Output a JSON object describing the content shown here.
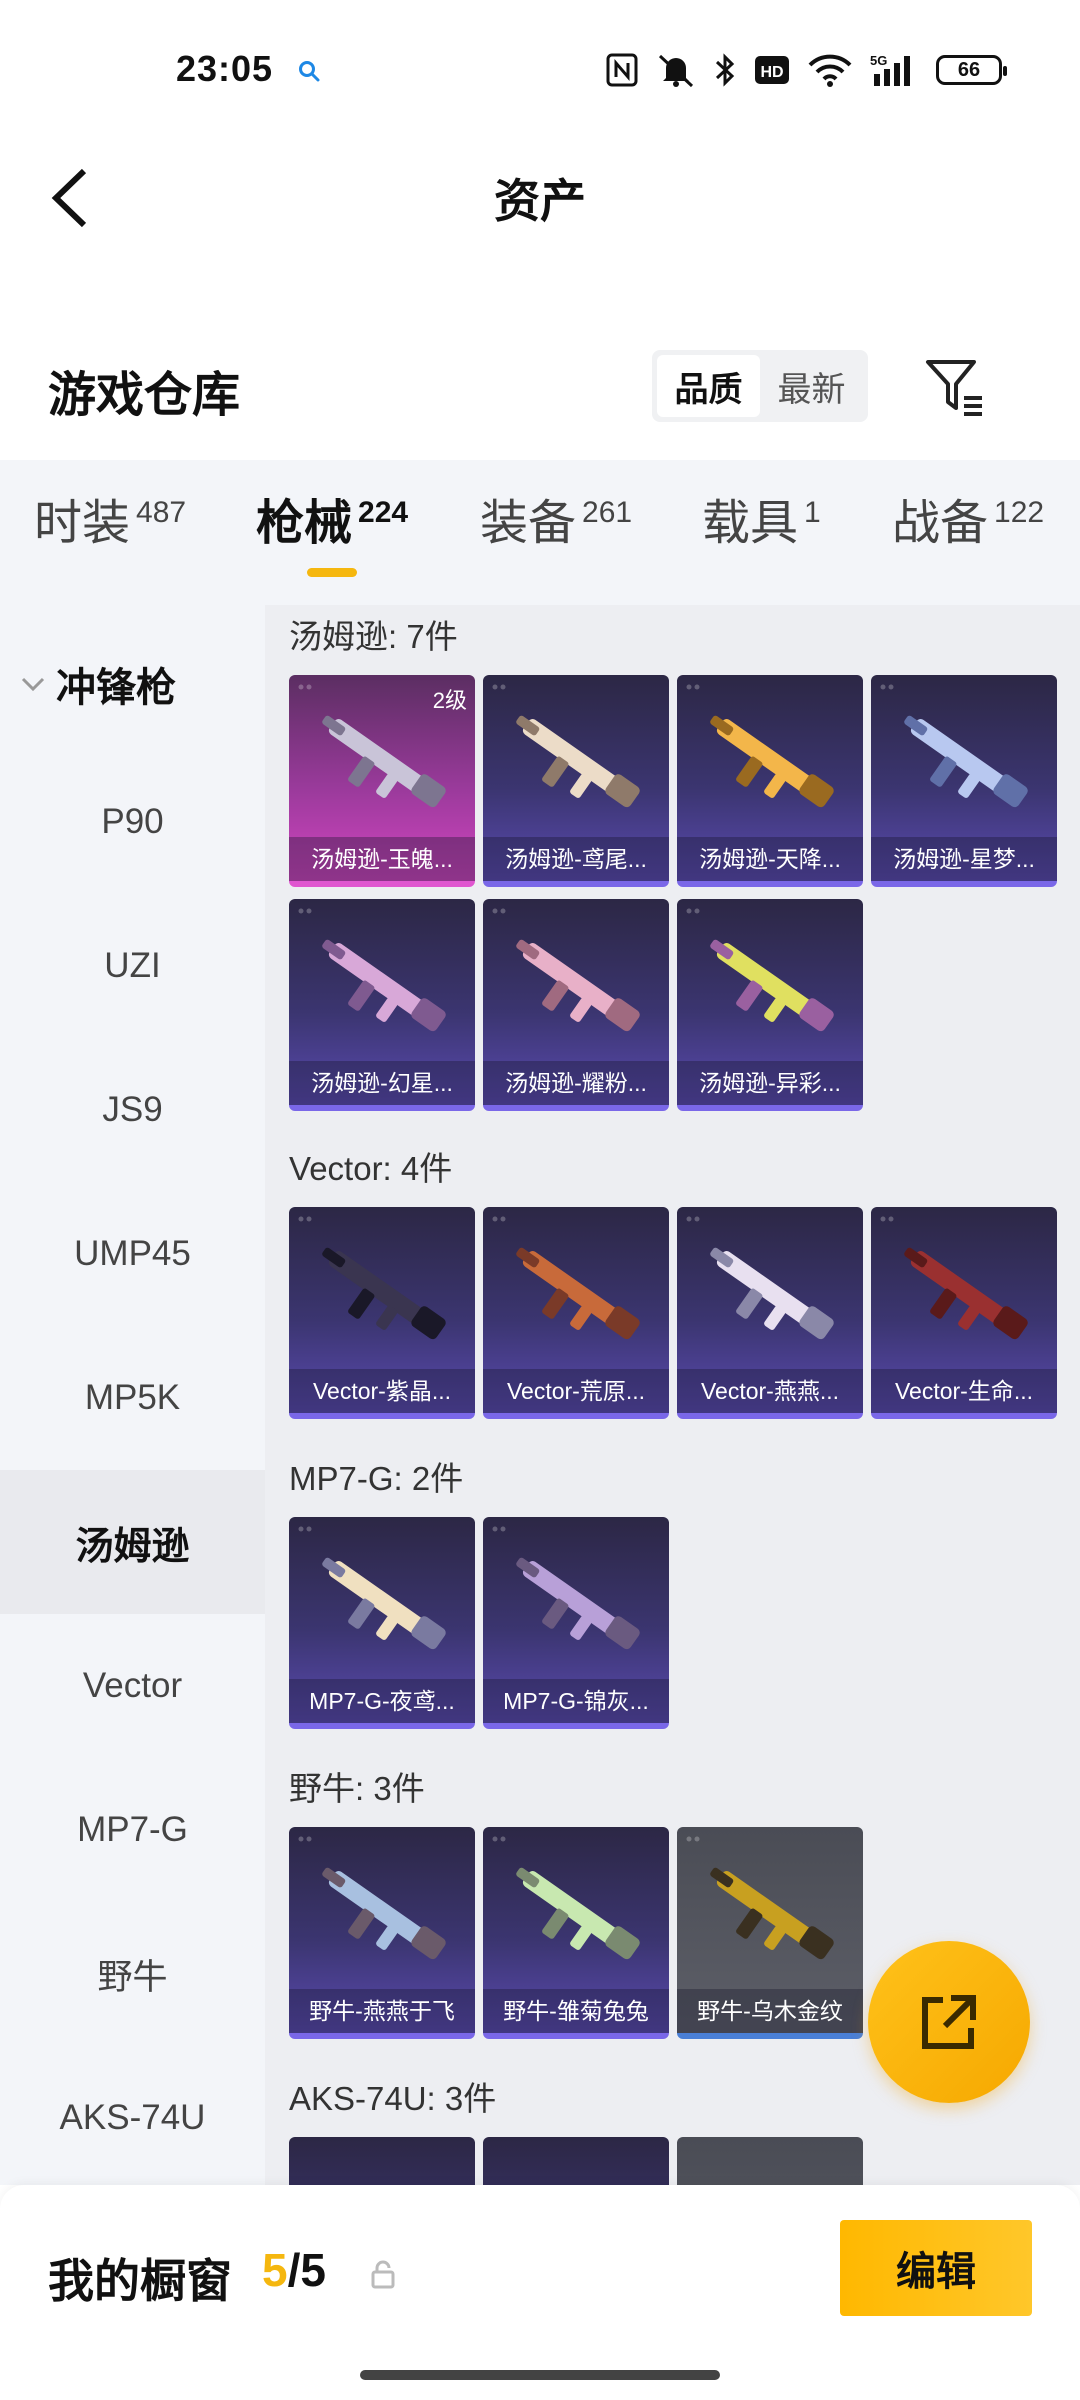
{
  "status_bar": {
    "time": "23:05",
    "battery": "66",
    "icons": [
      "search-icon",
      "nfc-icon",
      "mute-icon",
      "bluetooth-icon",
      "hd-icon",
      "wifi-icon",
      "5g-signal-icon",
      "battery-icon"
    ]
  },
  "header": {
    "title": "资产",
    "back_icon": "chevron-left-icon"
  },
  "section": {
    "title": "游戏仓库",
    "sort_options": [
      "品质",
      "最新"
    ],
    "sort_selected": "品质",
    "filter_icon": "filter-icon"
  },
  "tabs": [
    {
      "label": "时装",
      "count": "487"
    },
    {
      "label": "枪械",
      "count": "224",
      "active": true
    },
    {
      "label": "装备",
      "count": "261"
    },
    {
      "label": "载具",
      "count": "1"
    },
    {
      "label": "战备",
      "count": "122"
    }
  ],
  "sidebar": {
    "category": "冲锋枪",
    "items": [
      "P90",
      "UZI",
      "JS9",
      "UMP45",
      "MP5K",
      "汤姆逊",
      "Vector",
      "MP7-G",
      "野牛",
      "AKS-74U"
    ],
    "active": "汤姆逊"
  },
  "groups": [
    {
      "title": "汤姆逊: 7件",
      "items": [
        {
          "name": "汤姆逊-玉魄...",
          "level": "2级",
          "tier": "pink"
        },
        {
          "name": "汤姆逊-鸢尾...",
          "tier": "purple"
        },
        {
          "name": "汤姆逊-天降...",
          "tier": "purple"
        },
        {
          "name": "汤姆逊-星梦...",
          "tier": "purple"
        },
        {
          "name": "汤姆逊-幻星...",
          "tier": "purple"
        },
        {
          "name": "汤姆逊-耀粉...",
          "tier": "purple"
        },
        {
          "name": "汤姆逊-异彩...",
          "tier": "purple"
        }
      ]
    },
    {
      "title": "Vector: 4件",
      "items": [
        {
          "name": "Vector-紫晶...",
          "tier": "purple"
        },
        {
          "name": "Vector-荒原...",
          "tier": "purple"
        },
        {
          "name": "Vector-燕燕...",
          "tier": "purple"
        },
        {
          "name": "Vector-生命...",
          "tier": "purple"
        }
      ]
    },
    {
      "title": "MP7-G: 2件",
      "items": [
        {
          "name": "MP7-G-夜鸢...",
          "tier": "purple"
        },
        {
          "name": "MP7-G-锦灰...",
          "tier": "purple"
        }
      ]
    },
    {
      "title": "野牛: 3件",
      "items": [
        {
          "name": "野牛-燕燕于飞",
          "tier": "purple"
        },
        {
          "name": "野牛-雏菊兔兔",
          "tier": "purple"
        },
        {
          "name": "野牛-乌木金纹",
          "tier": "gray"
        }
      ]
    },
    {
      "title": "AKS-74U: 3件",
      "items": []
    }
  ],
  "fab": {
    "icon": "share-external-icon"
  },
  "bottom": {
    "title": "我的橱窗",
    "count_current": "5",
    "count_separator": "/",
    "count_total": "5",
    "lock_icon": "lock-icon",
    "edit_label": "编辑"
  },
  "colors": {
    "accent": "#f5b70f",
    "purple_tier": "#7a67e8",
    "pink_tier": "#e056d0",
    "gray_tier": "#4a7fd6"
  }
}
